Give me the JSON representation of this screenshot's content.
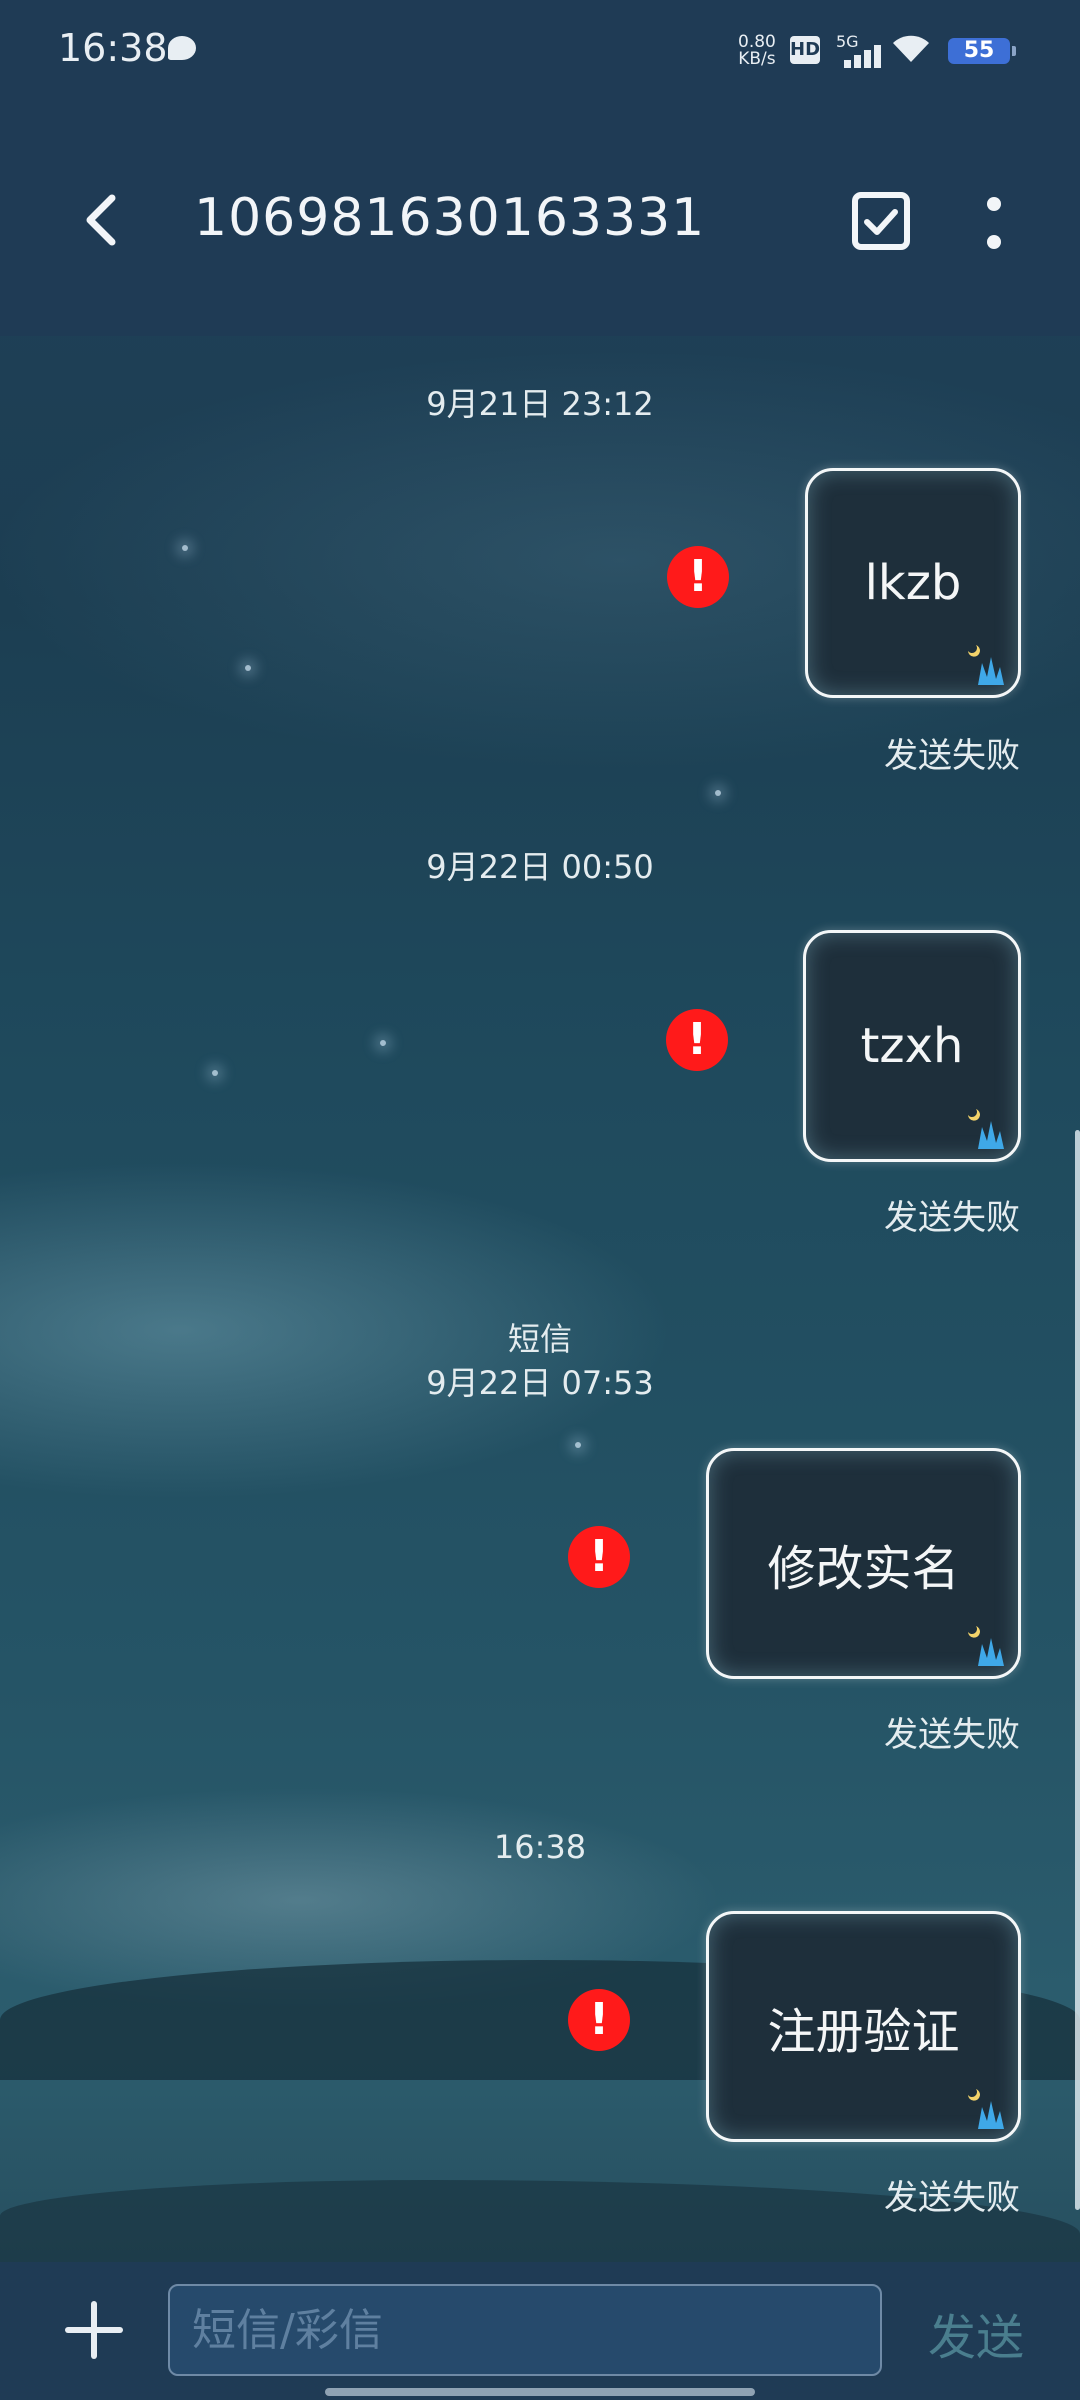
{
  "status_bar": {
    "time": "16:38",
    "net_speed_value": "0.80",
    "net_speed_unit": "KB/s",
    "hd_label": "HD",
    "network_label": "5G",
    "battery": "55"
  },
  "header": {
    "title": "106981630163331"
  },
  "messages": [
    {
      "timestamp": "9月21日 23:12",
      "text": "lkzb",
      "status": "发送失败"
    },
    {
      "timestamp": "9月22日 00:50",
      "text": "tzxh",
      "status": "发送失败"
    },
    {
      "timestamp_type": "短信",
      "timestamp": "9月22日 07:53",
      "text": "修改实名",
      "status": "发送失败"
    },
    {
      "timestamp": "16:38",
      "text": "注册验证",
      "status": "发送失败"
    }
  ],
  "error_icon_glyph": "!",
  "composer": {
    "placeholder": "短信/彩信",
    "send_label": "发送"
  }
}
